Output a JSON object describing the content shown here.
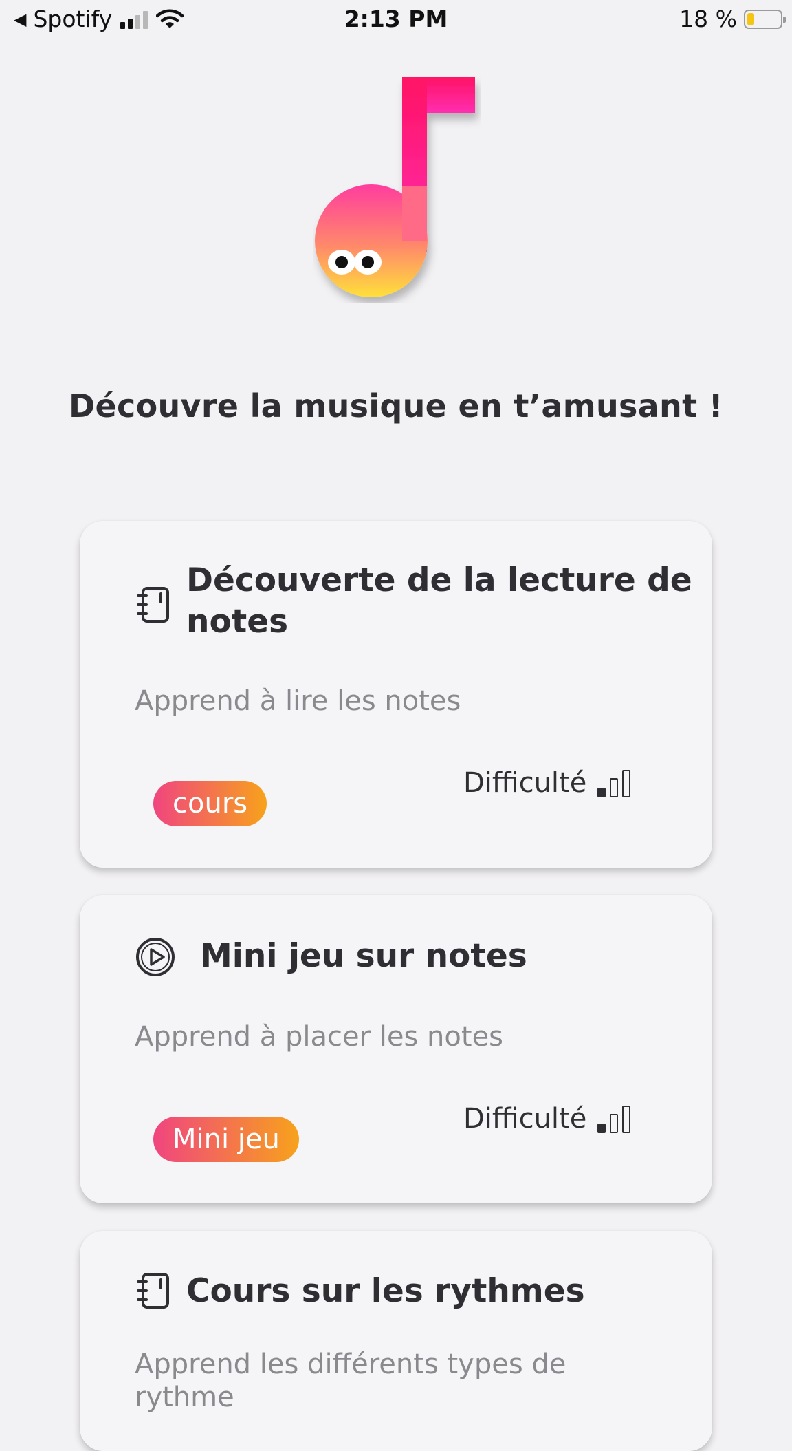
{
  "status_bar": {
    "back_app": "Spotify",
    "time": "2:13 PM",
    "battery": "18 %",
    "battery_level": 0.18
  },
  "logo": {
    "icon": "music-note-mascot-icon",
    "colors": [
      "#ff1264",
      "#ff2fa5",
      "#ffd838"
    ]
  },
  "headline": "Découvre la musique en t’amusant !",
  "cards": [
    {
      "icon": "notebook-icon",
      "title": "Découverte de la lecture de notes",
      "description": "Apprend à lire les notes",
      "tag": "cours",
      "difficulty_label": "Difficulté",
      "difficulty_level": 1,
      "difficulty_max": 3
    },
    {
      "icon": "play-circle-icon",
      "title": "Mini jeu sur notes",
      "description": "Apprend à placer les notes",
      "tag": "Mini jeu",
      "difficulty_label": "Difficulté",
      "difficulty_level": 1,
      "difficulty_max": 3
    },
    {
      "icon": "notebook-icon",
      "title": "Cours sur les rythmes",
      "description": "Apprend les différents types de rythme"
    }
  ],
  "colors": {
    "tag_gradient_start": "#f0457f",
    "tag_gradient_end": "#f7a21c",
    "background": "#f2f1f3",
    "card": "#f5f4f7"
  }
}
